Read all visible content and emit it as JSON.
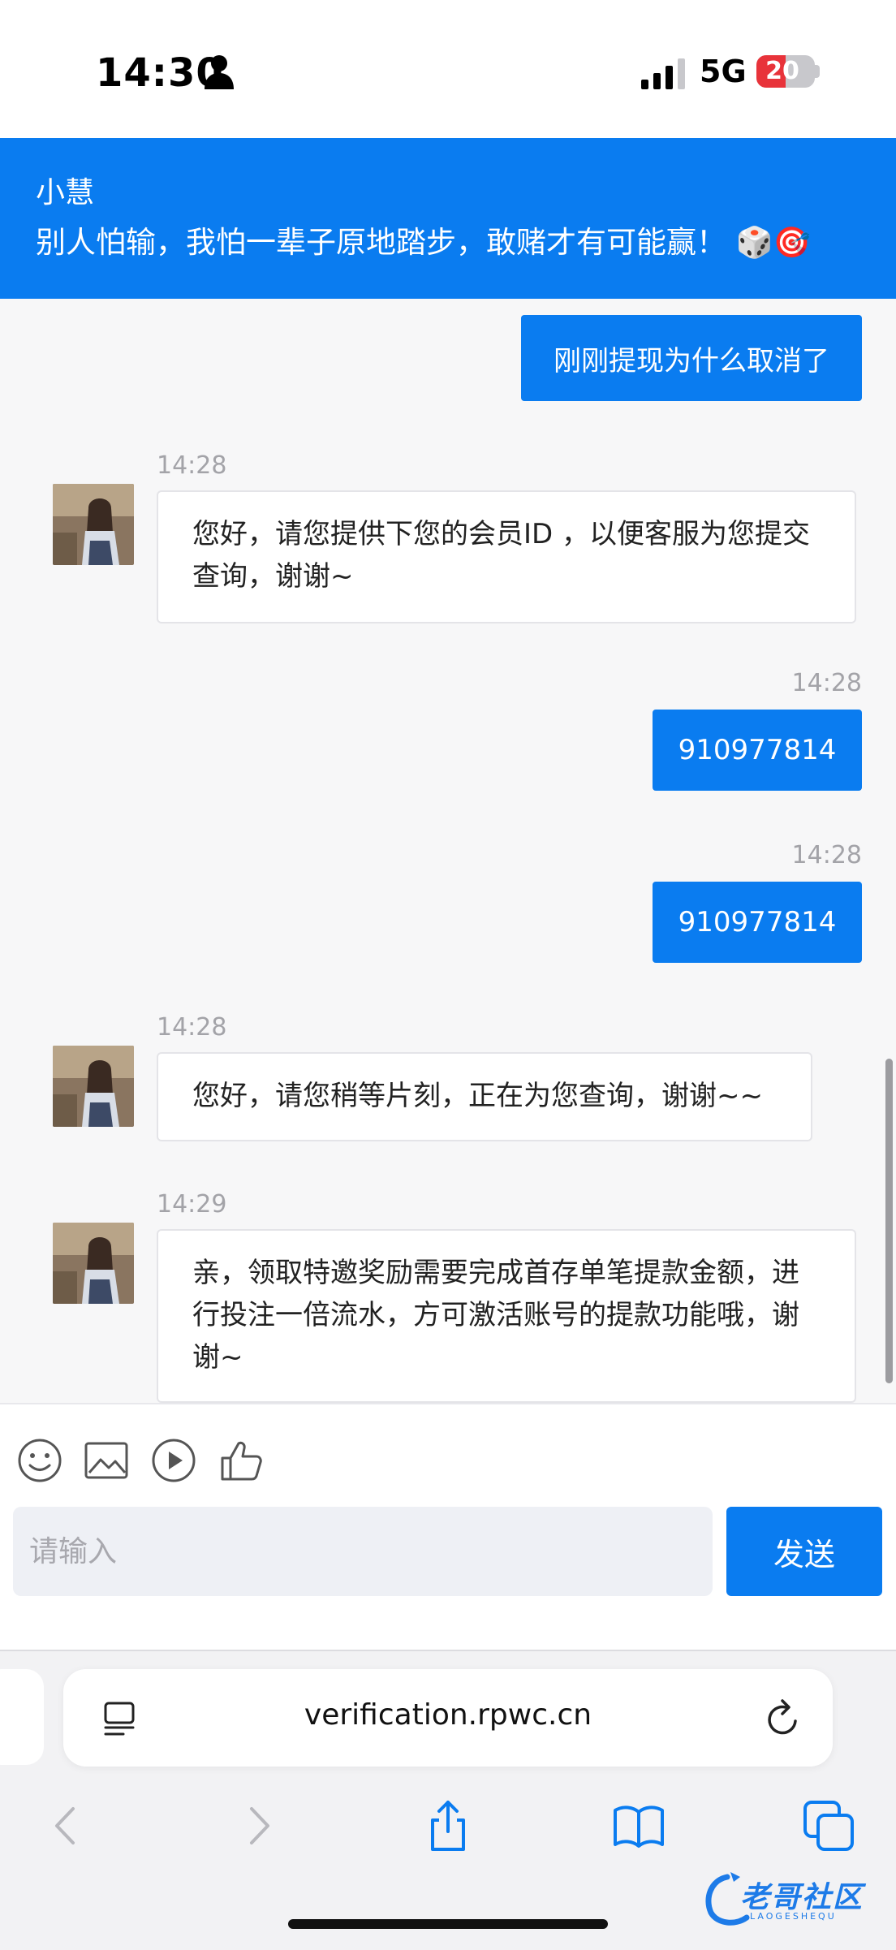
{
  "status_bar": {
    "time": "14:30",
    "network": "5G",
    "battery_level": "20",
    "battery_percent": 20,
    "icons": [
      "person-icon",
      "signal-icon",
      "battery-icon"
    ]
  },
  "header": {
    "name": "小慧",
    "motto": "别人怕输，我怕一辈子原地踏步，敢赌才有可能赢！ 🎲🎯"
  },
  "messages": [
    {
      "direction": "out",
      "text": "刚刚提现为什么取消了"
    },
    {
      "direction": "in",
      "time": "14:28",
      "text": "您好，请您提供下您的会员ID ，以便客服为您提交查询，谢谢~"
    },
    {
      "direction": "out",
      "time": "14:28",
      "text": "910977814"
    },
    {
      "direction": "out",
      "time": "14:28",
      "text": "910977814"
    },
    {
      "direction": "in",
      "time": "14:28",
      "text": "您好，请您稍等片刻，正在为您查询，谢谢~~"
    },
    {
      "direction": "in",
      "time": "14:29",
      "text": "亲，领取特邀奖励需要完成首存单笔提款金额，进行投注一倍流水，方可激活账号的提款功能哦，谢谢~"
    }
  ],
  "composer": {
    "placeholder": "请输入",
    "send_label": "发送",
    "tools": [
      "emoji-icon",
      "image-icon",
      "video-play-icon",
      "thumbs-up-icon"
    ]
  },
  "browser": {
    "url": "verification.rpwc.cn"
  },
  "watermark": {
    "text": "老哥社区",
    "sub": "LAOGESHEQU"
  },
  "colors": {
    "accent": "#0a7cf0",
    "chat_bg": "#f7f7f8",
    "timestamp": "#a3a3a8"
  }
}
